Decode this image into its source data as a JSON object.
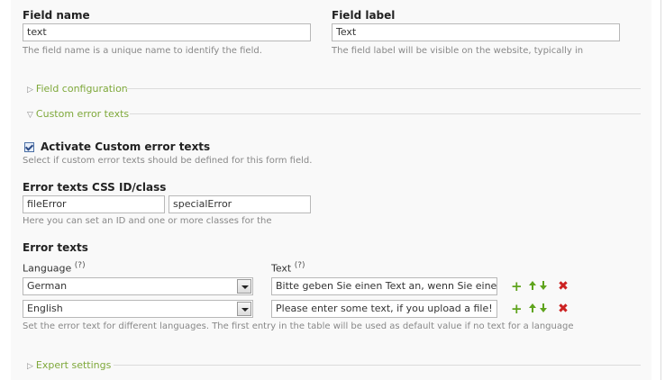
{
  "field_name": {
    "label": "Field name",
    "value": "text",
    "hint": "The field name is a unique name to identify the field."
  },
  "field_label": {
    "label": "Field label",
    "value": "Text",
    "hint": "The field label will be visible on the website, typically in"
  },
  "sections": {
    "field_configuration": "Field configuration",
    "custom_error_texts": "Custom error texts",
    "expert_settings": "Expert settings"
  },
  "activate": {
    "label": "Activate Custom error texts",
    "checked": true,
    "hint": "Select if custom error texts should be defined for this form field."
  },
  "css": {
    "label": "Error texts CSS ID/class",
    "id_value": "fileError",
    "class_value": "specialError",
    "hint": "Here you can set an ID and one or more classes for the"
  },
  "error_texts": {
    "label": "Error texts",
    "language_header": "Language",
    "text_header": "Text",
    "help_mark": "(?)",
    "rows": [
      {
        "language": "German",
        "text": "Bitte geben Sie einen Text an, wenn Sie eine Datei hochladen!"
      },
      {
        "language": "English",
        "text": "Please enter some text, if you upload a file!"
      }
    ],
    "hint": "Set the error text for different languages. The first entry in the table will be used as default value if no text for a language"
  },
  "icons": [
    "plus-icon",
    "move-up-icon",
    "move-down-icon",
    "delete-icon"
  ],
  "colors": {
    "accent_green": "#7ea83a",
    "delete_red": "#cc2222"
  }
}
